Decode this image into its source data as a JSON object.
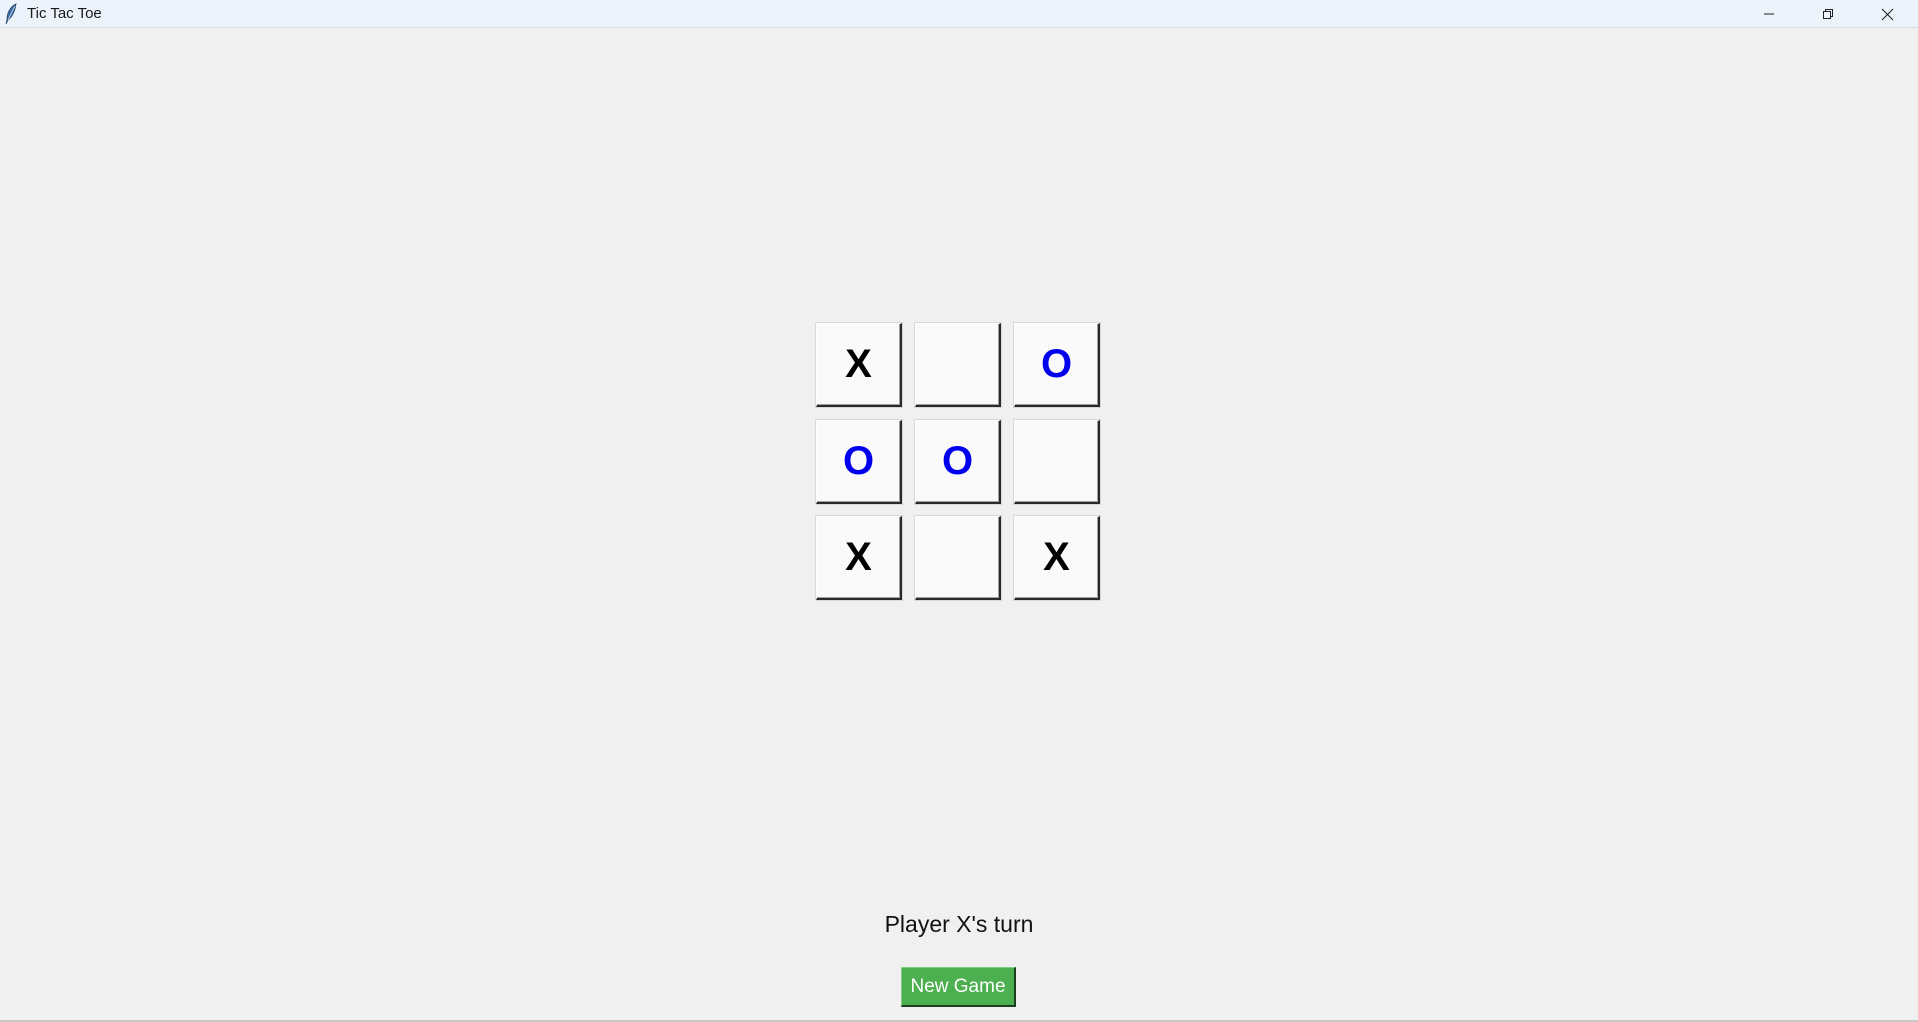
{
  "window": {
    "title": "Tic Tac Toe",
    "icon": "feather-icon",
    "controls": [
      "minimize-icon",
      "restore-icon",
      "close-icon"
    ]
  },
  "board": {
    "cells": [
      [
        "X",
        "",
        "O"
      ],
      [
        "O",
        "O",
        ""
      ],
      [
        "X",
        "",
        "X"
      ]
    ],
    "colors": {
      "X": "#000000",
      "O": "#0000ee"
    }
  },
  "status": {
    "text": "Player X's turn"
  },
  "actions": {
    "new_game_label": "New Game",
    "new_game_color": "#4caf50"
  }
}
